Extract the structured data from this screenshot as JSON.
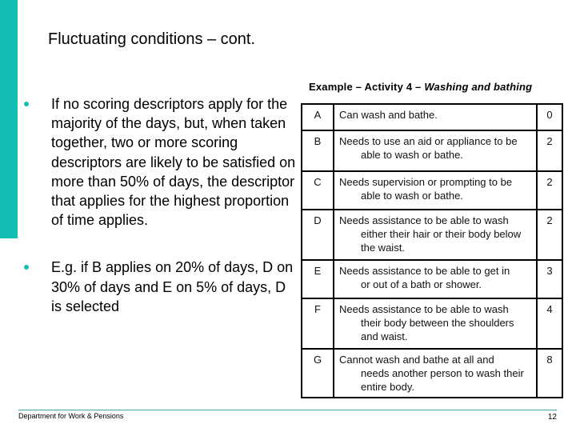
{
  "slide": {
    "title": "Fluctuating conditions – cont.",
    "accent_color": "#14BDB2"
  },
  "bullets": [
    {
      "icon": "bullet-dot",
      "text": "If no scoring descriptors apply for the majority of the days, but, when taken together, two or more scoring descriptors are likely to be satisfied on more than 50% of days, the descriptor that applies for the highest proportion of time applies."
    },
    {
      "icon": "bullet-dot",
      "text": "E.g. if B applies on 20% of days, D on 30% of days and E on 5% of days, D is selected"
    }
  ],
  "example": {
    "heading_prefix": "Example – Activity 4 – ",
    "heading_activity": "Washing and bathing",
    "rows": [
      {
        "letter": "A",
        "first": "Can wash and bathe.",
        "rest": "",
        "score": "0"
      },
      {
        "letter": "B",
        "first": "Needs to use an aid or appliance to be",
        "rest": "able to wash or bathe.",
        "score": "2"
      },
      {
        "letter": "C",
        "first": "Needs supervision or prompting to be",
        "rest": "able to wash or bathe.",
        "score": "2"
      },
      {
        "letter": "D",
        "first": "Needs assistance to be able to wash",
        "rest": "either their hair or their body below the waist.",
        "score": "2"
      },
      {
        "letter": "E",
        "first": "Needs assistance to be able to get in",
        "rest": "or out of a bath or shower.",
        "score": "3"
      },
      {
        "letter": "F",
        "first": "Needs assistance to be able to wash",
        "rest": "their body between the shoulders and waist.",
        "score": "4"
      },
      {
        "letter": "G",
        "first": "Cannot wash and bathe at all and",
        "rest": "needs another person to wash their entire body.",
        "score": "8"
      }
    ]
  },
  "footer": {
    "department": "Department for Work & Pensions",
    "page_number": "12"
  }
}
